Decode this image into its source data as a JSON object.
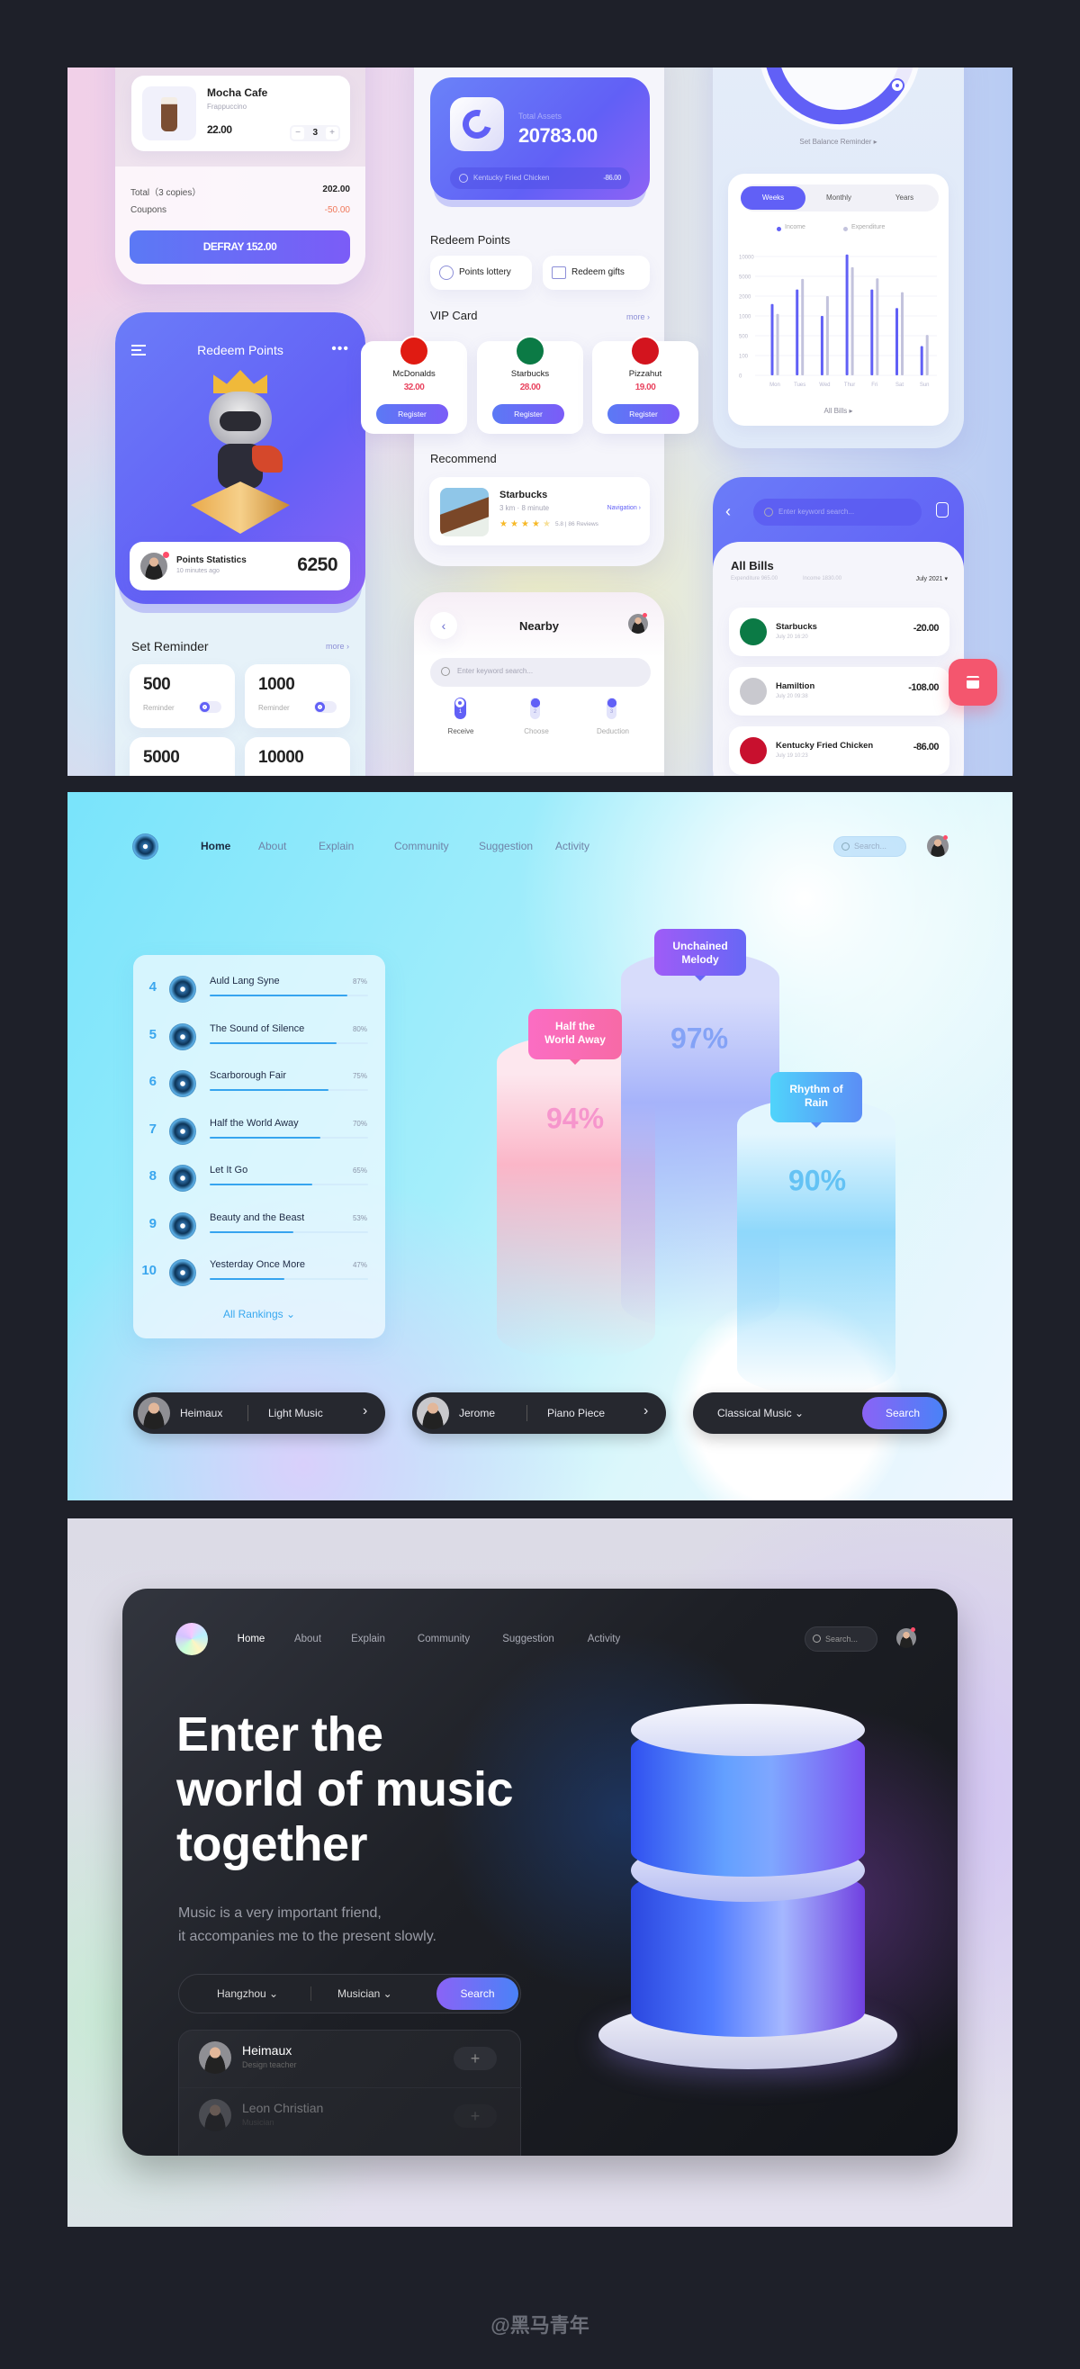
{
  "panel1": {
    "cart": {
      "item_name": "Mocha Cafe",
      "item_sub": "Frappuccino",
      "price": "22.00",
      "minus": "−",
      "qty": "3",
      "plus": "+",
      "total_label": "Total（3 copies）",
      "total_value": "202.00",
      "coupons_label": "Coupons",
      "coupons_value": "-50.00",
      "defray": "DEFRAY 152.00"
    },
    "redeem": {
      "title": "Redeem Points",
      "stats_title": "Points Statistics",
      "stats_time": "10 minutes ago",
      "stats_value": "6250",
      "reminder_title": "Set Reminder",
      "more": "more ›",
      "reminders": [
        {
          "value": "500",
          "label": "Reminder",
          "on": true
        },
        {
          "value": "1000",
          "label": "Reminder",
          "on": true
        },
        {
          "value": "5000"
        },
        {
          "value": "10000"
        }
      ]
    },
    "wallet": {
      "assets_label": "Total Assets",
      "assets_value": "20783.00",
      "last_tx_name": "Kentucky Fried Chicken",
      "last_tx_amount": "-86.00",
      "redeem_title": "Redeem Points",
      "chips": [
        "Points lottery",
        "Redeem gifts"
      ],
      "vip_title": "VIP Card",
      "vip_more": "more ›",
      "vip_cards": [
        {
          "name": "McDonalds",
          "price": "32.00",
          "button": "Register",
          "color": "#e01b12"
        },
        {
          "name": "Starbucks",
          "price": "28.00",
          "button": "Register",
          "color": "#0b7a45"
        },
        {
          "name": "Pizzahut",
          "price": "19.00",
          "button": "Register",
          "color": "#d3141e"
        }
      ],
      "recommend_title": "Recommend",
      "recommend": {
        "name": "Starbucks",
        "meta": "3 km · 8 minute",
        "nav": "Navigation ›",
        "rating": 3.5,
        "rating_text": "5.8 | 86 Reviews"
      }
    },
    "nearby": {
      "title": "Nearby",
      "search_placeholder": "Enter keyword search...",
      "steps": [
        {
          "num": "1",
          "label": "Receive"
        },
        {
          "num": "2",
          "label": "Choose"
        },
        {
          "num": "3",
          "label": "Deduction"
        }
      ],
      "active_step": 0
    },
    "balance": {
      "reminder_link": "Set Balance Reminder ▸",
      "tabs": [
        "Weeks",
        "Monthly",
        "Years"
      ],
      "active_tab": 0,
      "all_bills": "All Bills ▸"
    },
    "bills": {
      "search_placeholder": "Enter keyword search...",
      "title": "All Bills",
      "expenditure": "Expenditure 965.00",
      "income": "Income 1830.00",
      "month": "July 2021 ▾",
      "items": [
        {
          "name": "Starbucks",
          "time": "July 20 16:20",
          "amount": "-20.00",
          "icon": "starbucks-logo"
        },
        {
          "name": "Hamiltion",
          "time": "July 20 09:38",
          "amount": "-108.00",
          "icon": "avatar"
        },
        {
          "name": "Kentucky Fried Chicken",
          "time": "July 19 10:23",
          "amount": "-86.00",
          "icon": "kfc-logo"
        }
      ]
    },
    "colors": {
      "primary": "#6160f6",
      "danger": "#f4566e",
      "price_red": "#e94560",
      "coupon": "#f0785a"
    }
  },
  "chart_data": {
    "type": "bar",
    "categories": [
      "Mon",
      "Tues",
      "Wed",
      "Thur",
      "Fri",
      "Sat",
      "Sun"
    ],
    "series": [
      {
        "name": "Income",
        "color": "#6160f6",
        "values": [
          1600,
          3000,
          1000,
          10500,
          3000,
          1400,
          290
        ]
      },
      {
        "name": "Expenditure",
        "color": "#c3c3dd",
        "values": [
          1100,
          4600,
          2000,
          7300,
          4700,
          2600,
          520
        ]
      }
    ],
    "yticks": [
      0,
      100,
      500,
      1000,
      2000,
      5000,
      10000
    ],
    "ylim": [
      0,
      10000
    ],
    "legend": "top",
    "grid": true
  },
  "panel2": {
    "nav": [
      "Home",
      "About",
      "Explain",
      "Community",
      "Suggestion",
      "Activity"
    ],
    "active_nav": 0,
    "search_placeholder": "Search...",
    "rankings": [
      {
        "rank": "4",
        "title": "Auld Lang Syne",
        "percent": 87
      },
      {
        "rank": "5",
        "title": "The Sound of Silence",
        "percent": 80
      },
      {
        "rank": "6",
        "title": "Scarborough Fair",
        "percent": 75
      },
      {
        "rank": "7",
        "title": "Half the World Away",
        "percent": 70
      },
      {
        "rank": "8",
        "title": "Let It Go",
        "percent": 65
      },
      {
        "rank": "9",
        "title": "Beauty and the Beast",
        "percent": 53
      },
      {
        "rank": "10",
        "title": "Yesterday Once More",
        "percent": 47
      }
    ],
    "all_rankings": "All Rankings ⌄",
    "podium": [
      {
        "title": "Half the World Away",
        "percent": "94%"
      },
      {
        "title": "Unchained Melody",
        "percent": "97%"
      },
      {
        "title": "Rhythm of Rain",
        "percent": "90%"
      }
    ],
    "pills": [
      {
        "name": "Heimaux",
        "genre": "Light Music"
      },
      {
        "name": "Jerome",
        "genre": "Piano Piece"
      }
    ],
    "genre_select": "Classical Music ⌄",
    "search_button": "Search"
  },
  "panel3": {
    "nav": [
      "Home",
      "About",
      "Explain",
      "Community",
      "Suggestion",
      "Activity"
    ],
    "active_nav": 0,
    "search_placeholder": "Search...",
    "headline": [
      "Enter the",
      "world of music",
      "together"
    ],
    "subtext": [
      "Music is a very important friend,",
      "it accompanies me to the present slowly."
    ],
    "city": "Hangzhou ⌄",
    "role": "Musician ⌄",
    "search_button": "Search",
    "people": [
      {
        "name": "Heimaux",
        "role": "Design teacher",
        "add": "+"
      },
      {
        "name": "Leon Christian",
        "role": "Musician",
        "add": "+"
      }
    ]
  },
  "watermark": "@黑马青年"
}
